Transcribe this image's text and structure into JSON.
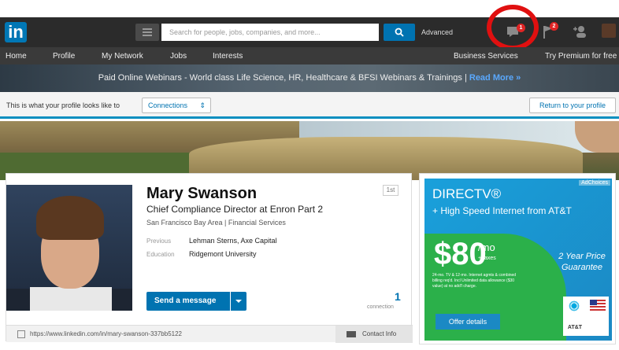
{
  "topbar": {
    "logo": "in",
    "search_placeholder": "Search for people, jobs, companies, and more...",
    "advanced": "Advanced",
    "messages_badge": "1",
    "notifications_badge": "2"
  },
  "nav": {
    "items": [
      "Home",
      "Profile",
      "My Network",
      "Jobs",
      "Interests"
    ],
    "business": "Business Services",
    "premium": "Try Premium for free"
  },
  "ad_banner": {
    "text": "Paid Online Webinars - World class Life Science, HR, Healthcare & BFSI Webinars & Trainings |",
    "link": "Read More »"
  },
  "view_bar": {
    "label": "This is what your profile looks like to",
    "select": "Connections",
    "return_button": "Return to your profile"
  },
  "profile": {
    "name": "Mary Swanson",
    "headline": "Chief Compliance Director at Enron Part 2",
    "location": "San Francisco Bay Area",
    "industry": "Financial Services",
    "location_line": "San Francisco Bay Area  |  Financial Services",
    "previous_label": "Previous",
    "previous": "Lehman Sterns, Axe Capital",
    "education_label": "Education",
    "education": "Ridgemont University",
    "degree": "1st",
    "send_message": "Send a message",
    "connections_count": "1",
    "connections_label": "connection",
    "url": "https://www.linkedin.com/in/mary-swanson-337bb5122",
    "contact_info": "Contact Info"
  },
  "ad": {
    "adchoices": "AdChoices",
    "brand": "DIRECTV®",
    "headline": "+ High Speed Internet from AT&T",
    "price": "$80",
    "per": "/mo",
    "taxes": "+ taxes",
    "fine_print": "24-mo. TV & 12-mo. Internet agmts & combined billing req'd. Incl Unlimited data allowance ($30 value) at no add'l charge.",
    "guarantee": "2 Year Price Guarantee",
    "offer_button": "Offer details",
    "att": "AT&T"
  },
  "colors": {
    "linkedin_blue": "#0077b5",
    "topbar": "#2b2b2b",
    "badge_red": "#e02424",
    "annotation_red": "#e01010"
  }
}
